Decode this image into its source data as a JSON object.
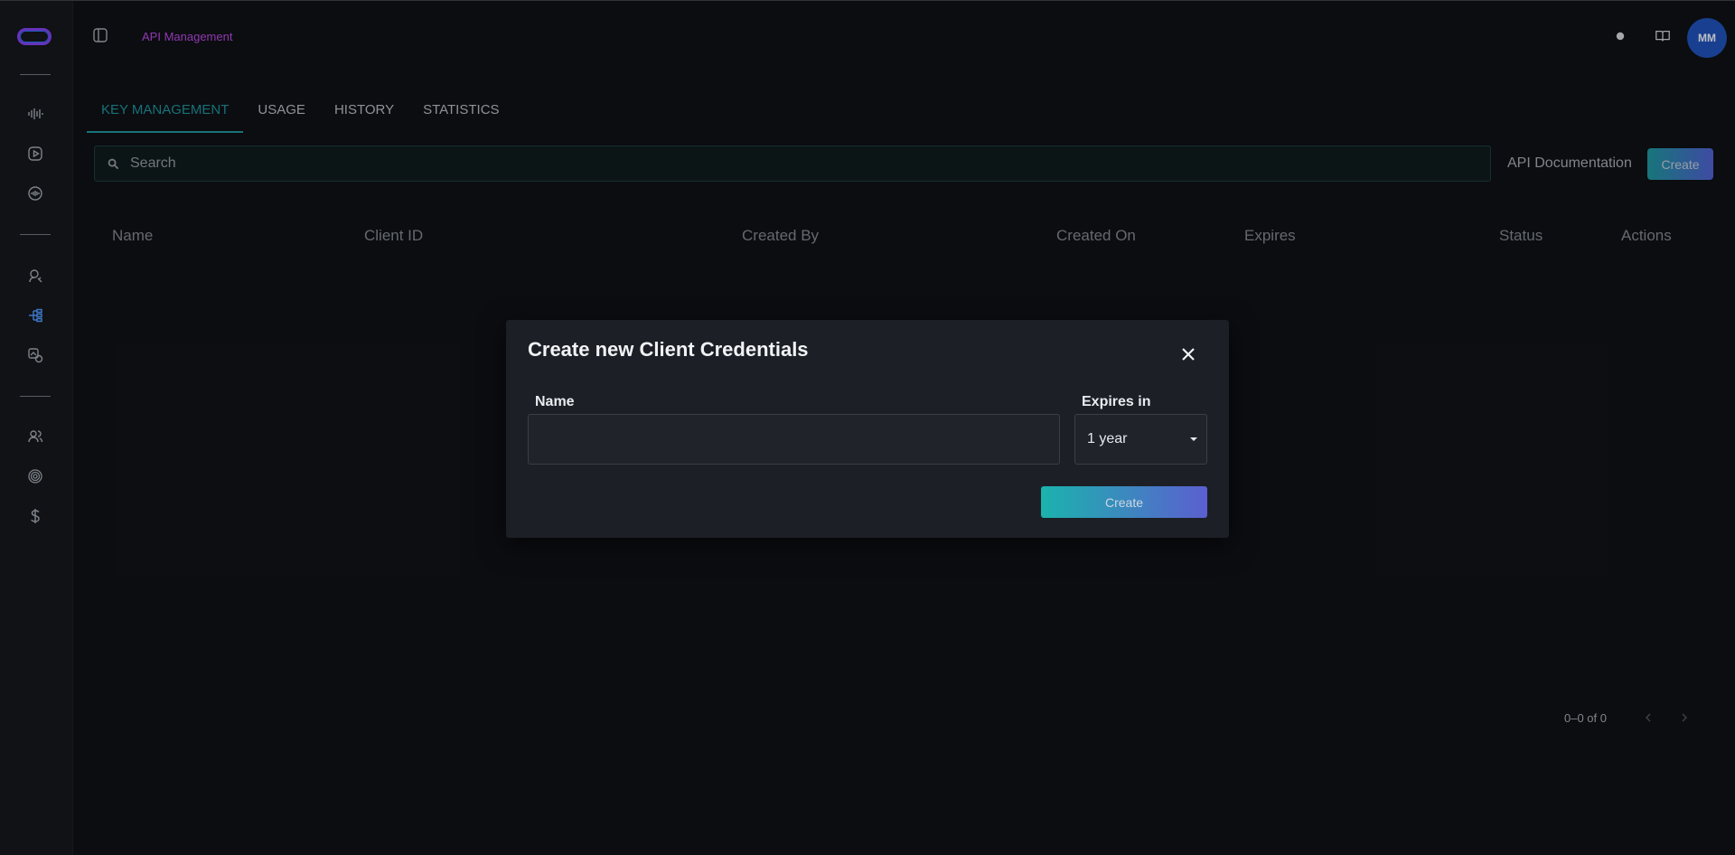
{
  "header": {
    "breadcrumb": "API Management",
    "avatar_initials": "MM",
    "icons": [
      "panel-toggle-icon",
      "theme-icon",
      "docs-book-icon"
    ]
  },
  "sidebar": {
    "icons": [
      "waveform-icon",
      "video-play-icon",
      "chat-bubble-icon",
      "voice-badge-icon",
      "api-tree-icon",
      "image-settings-icon",
      "users-icon",
      "fingerprint-icon",
      "dollar-icon"
    ],
    "active": "api-tree-icon"
  },
  "tabs": [
    {
      "label": "KEY MANAGEMENT",
      "active": true
    },
    {
      "label": "USAGE",
      "active": false
    },
    {
      "label": "HISTORY",
      "active": false
    },
    {
      "label": "STATISTICS",
      "active": false
    }
  ],
  "search": {
    "placeholder": "Search"
  },
  "actions": {
    "api_doc": "API Documentation",
    "create": "Create"
  },
  "table": {
    "columns": [
      "Name",
      "Client ID",
      "Created By",
      "Created On",
      "Expires",
      "Status",
      "Actions"
    ],
    "rows": []
  },
  "pagination": {
    "range": "0–0 of 0"
  },
  "modal": {
    "title": "Create new Client Credentials",
    "name_label": "Name",
    "name_value": "",
    "expires_label": "Expires in",
    "expires_value": "1 year",
    "submit": "Create"
  },
  "colors": {
    "accent": "#1d8a94",
    "brand_gradient_start": "#1bb3ad",
    "brand_gradient_end": "#5b5fd0",
    "breadcrumb": "#b045d8",
    "active_icon": "#4a8ff0"
  }
}
